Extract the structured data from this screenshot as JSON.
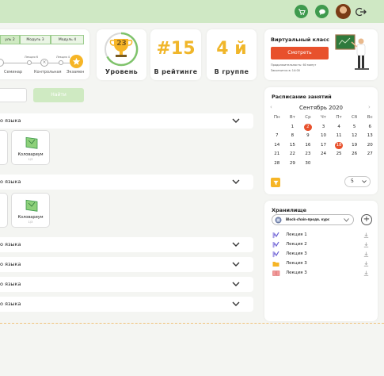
{
  "colors": {
    "brand_green": "#3f9a4e",
    "accent_orange": "#e8512c",
    "accent_yellow": "#f6b526",
    "topbar_bg": "#cfe8c4"
  },
  "topbar": {
    "icons": [
      "cart-icon",
      "chat-icon",
      "avatar",
      "logout-icon"
    ]
  },
  "modules": {
    "tabs": [
      "уль 2",
      "Модуль 3",
      "Модуль 4"
    ],
    "timeline": {
      "small_labels": [
        "Лекция 6",
        "Лекция 4"
      ],
      "node_mark": "×"
    },
    "steps": [
      "Семинар",
      "Контрольная",
      "Экзамен"
    ]
  },
  "stats": {
    "level": {
      "value": "23",
      "label": "Уровень"
    },
    "rating": {
      "value": "#15",
      "label": "В рейтинге"
    },
    "group": {
      "value": "4 й",
      "label": "В группе"
    }
  },
  "virtual_class": {
    "title": "Виртуальный класс",
    "button": "Смотреть",
    "duration": "Продолжительность: 60 минут",
    "ends": "Закончится в: 14:00"
  },
  "search": {
    "button": "Найти"
  },
  "subjects": [
    {
      "label": "о языка",
      "expanded": true,
      "tile": {
        "name": "Коловариум",
        "count": "1/3"
      }
    },
    {
      "label": "о языка",
      "expanded": true,
      "tile": {
        "name": "Коловариум",
        "count": "1/3"
      }
    },
    {
      "label": "о языка",
      "expanded": false
    },
    {
      "label": "о языка",
      "expanded": false
    },
    {
      "label": "о языка",
      "expanded": false
    },
    {
      "label": "о языка",
      "expanded": false
    }
  ],
  "schedule": {
    "title": "Расписание занятий",
    "month": "Сентябрь 2020",
    "weekdays": [
      "Пн",
      "Вт",
      "Ср",
      "Чт",
      "Пт",
      "Сб",
      "Вс"
    ],
    "days": [
      "",
      "1",
      "2",
      "3",
      "4",
      "5",
      "6",
      "7",
      "8",
      "9",
      "10",
      "11",
      "12",
      "13",
      "14",
      "15",
      "16",
      "17",
      "18",
      "19",
      "20",
      "21",
      "22",
      "23",
      "24",
      "25",
      "26",
      "27",
      "28",
      "29",
      "30"
    ],
    "highlighted_days": [
      "2",
      "18"
    ],
    "page_size": "5"
  },
  "storage": {
    "title": "Хранилище",
    "course": "Block-chain-продв. курс",
    "files": [
      {
        "name": "Лекция 1",
        "icon": "chart-file-icon"
      },
      {
        "name": "Лекция 2",
        "icon": "chart-file-icon"
      },
      {
        "name": "Лекция 3",
        "icon": "chart-file-icon"
      },
      {
        "name": "Лекция 3",
        "icon": "folder-icon"
      },
      {
        "name": "Лекция 3",
        "icon": "book-icon"
      }
    ]
  }
}
